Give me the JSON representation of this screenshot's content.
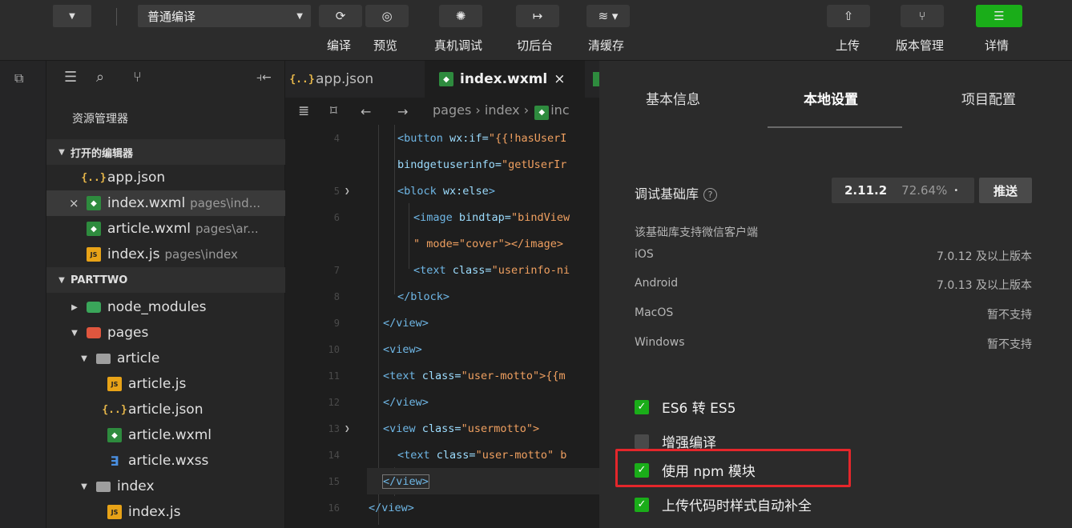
{
  "toolbar": {
    "compile_mode": "普通编译",
    "buttons": [
      {
        "label": "编译",
        "icon": "refresh-icon"
      },
      {
        "label": "预览",
        "icon": "eye-icon"
      },
      {
        "label": "真机调试",
        "icon": "bug-icon"
      },
      {
        "label": "切后台",
        "icon": "switch-background-icon"
      },
      {
        "label": "清缓存",
        "icon": "layers-icon"
      }
    ],
    "right_buttons": [
      {
        "label": "上传",
        "icon": "upload-icon"
      },
      {
        "label": "版本管理",
        "icon": "branch-icon"
      },
      {
        "label": "详情",
        "icon": "menu-icon"
      }
    ]
  },
  "explorer": {
    "title": "资源管理器",
    "open_editors_label": "打开的编辑器",
    "open_editors": [
      {
        "name": "app.json",
        "path": ""
      },
      {
        "name": "index.wxml",
        "path": "pages\\ind..."
      },
      {
        "name": "article.wxml",
        "path": "pages\\ar..."
      },
      {
        "name": "index.js",
        "path": "pages\\index"
      }
    ],
    "project_label": "PARTTWO",
    "tree": [
      {
        "name": "node_modules"
      },
      {
        "name": "pages"
      },
      {
        "name": "article"
      },
      {
        "name": "article.js"
      },
      {
        "name": "article.json"
      },
      {
        "name": "article.wxml"
      },
      {
        "name": "article.wxss"
      },
      {
        "name": "index"
      },
      {
        "name": "index.js"
      }
    ]
  },
  "editor": {
    "tabs": [
      {
        "name": "app.json"
      },
      {
        "name": "index.wxml",
        "close": "×"
      }
    ],
    "breadcrumb": {
      "seg1": "pages",
      "seg2": "index",
      "seg3": "inc"
    },
    "lines": [
      {
        "num": "4",
        "c1": "<button ",
        "c2": "wx:if=",
        "c3": "\"{{!hasUserI"
      },
      {
        "num": "",
        "c1": "",
        "c2": "bindgetuserinfo=",
        "c3": "\"getUserIr"
      },
      {
        "num": "5",
        "c1": "<block ",
        "c2": "wx:else",
        "c3": ">"
      },
      {
        "num": "6",
        "c1": "<image ",
        "c2": "bindtap=",
        "c3": "\"bindView"
      },
      {
        "num": "",
        "c1": "",
        "c2": "\" mode=",
        "c3": "\"cover\"></image>"
      },
      {
        "num": "7",
        "c1": "<text ",
        "c2": "class=",
        "c3": "\"userinfo-ni"
      },
      {
        "num": "8",
        "c1": "</block>",
        "c2": "",
        "c3": ""
      },
      {
        "num": "9",
        "c1": "</view>",
        "c2": "",
        "c3": ""
      },
      {
        "num": "10",
        "c1": "<view>",
        "c2": "",
        "c3": ""
      },
      {
        "num": "11",
        "c1": "<text ",
        "c2": "class=",
        "c3": "\"user-motto\">{{m"
      },
      {
        "num": "12",
        "c1": "</view>",
        "c2": "",
        "c3": ""
      },
      {
        "num": "13",
        "c1": "<view ",
        "c2": "class=",
        "c3": "\"usermotto\">"
      },
      {
        "num": "14",
        "c1": "<text ",
        "c2": "class=",
        "c3": "\"user-motto\" b"
      },
      {
        "num": "15",
        "c1": "</view>",
        "c2": "",
        "c3": ""
      },
      {
        "num": "16",
        "c1": "</view>",
        "c2": "",
        "c3": ""
      }
    ]
  },
  "details": {
    "tabs": [
      "基本信息",
      "本地设置",
      "项目配置"
    ],
    "lib_label": "调试基础库",
    "lib_version": "2.11.2",
    "lib_percent": "72.64%",
    "lib_dot": "•",
    "push_label": "推送",
    "support_label": "该基础库支持微信客户端",
    "platforms": [
      {
        "name": "iOS",
        "value": "7.0.12 及以上版本"
      },
      {
        "name": "Android",
        "value": "7.0.13 及以上版本"
      },
      {
        "name": "MacOS",
        "value": "暂不支持"
      },
      {
        "name": "Windows",
        "value": "暂不支持"
      }
    ],
    "options": [
      {
        "label": "ES6 转 ES5",
        "checked": true,
        "mark": "✓"
      },
      {
        "label": "增强编译",
        "checked": false,
        "mark": ""
      },
      {
        "label": "使用 npm 模块",
        "checked": true,
        "mark": "✓"
      },
      {
        "label": "上传代码时样式自动补全",
        "checked": true,
        "mark": "✓"
      }
    ]
  },
  "colors": {
    "accent": "#1aad19",
    "highlight": "#e4262b"
  }
}
